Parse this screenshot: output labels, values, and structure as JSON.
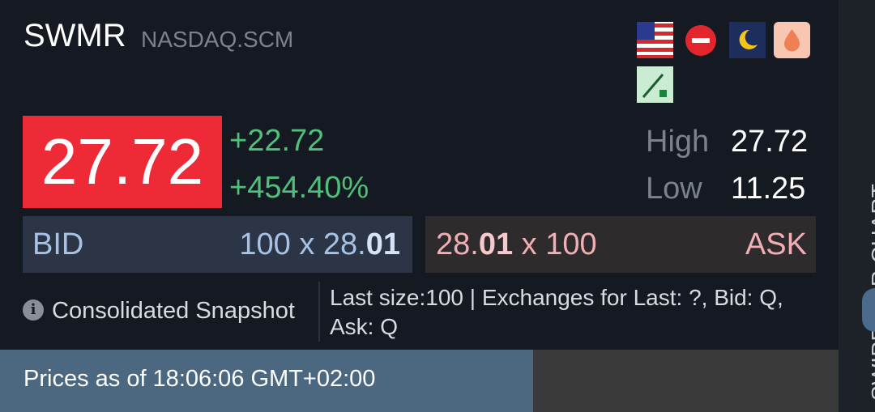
{
  "quote": {
    "symbol": "SWMR",
    "exchange": "NASDAQ.SCM",
    "price": "27.72",
    "change": "+22.72",
    "change_pct": "+454.40%",
    "high_label": "High",
    "high": "27.72",
    "low_label": "Low",
    "low": "11.25"
  },
  "icons": [
    "us-flag-icon",
    "no-entry-icon",
    "moon-icon",
    "drop-icon",
    "slash-icon"
  ],
  "bid": {
    "label": "BID",
    "size": "100",
    "x": " x ",
    "price_main": "28.",
    "price_hi": "01"
  },
  "ask": {
    "label": "ASK",
    "size": "100",
    "x": " x ",
    "price_main": "28.",
    "price_hi": "01"
  },
  "snapshot_label": "Consolidated Snapshot",
  "last_info": "Last size:100 | Exchanges for Last: ?, Bid: Q, Ask: Q",
  "footer": {
    "prices_as_of": "Prices as of 18:06:06 GMT+02:00"
  },
  "side": {
    "label": "SWIPE FOR CHART"
  },
  "colors": {
    "price_bg": "#ee2a37",
    "up": "#4fc07a",
    "bid": "#a8c2e6",
    "ask": "#f1aeb4",
    "footer": "#4b6880"
  }
}
